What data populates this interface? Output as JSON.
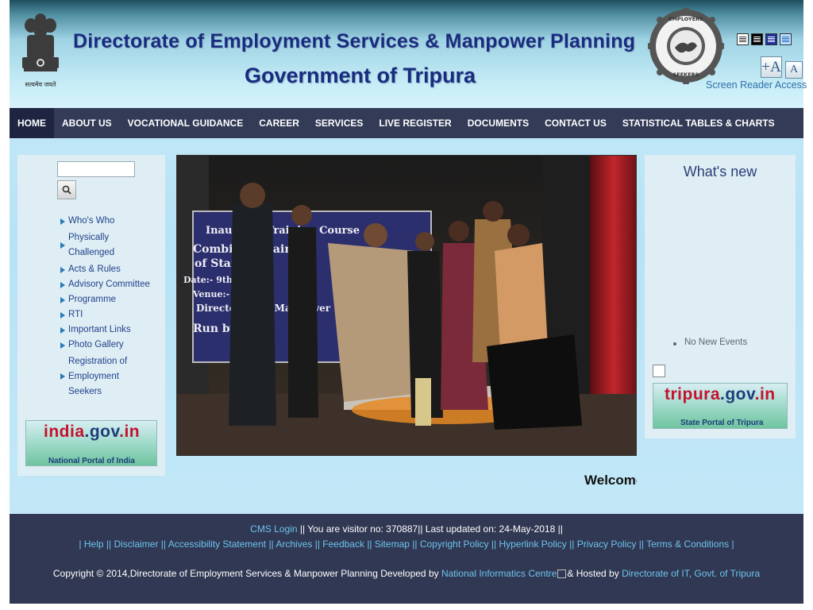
{
  "header": {
    "title_line1": "Directorate of Employment Services & Manpower Planning",
    "title_line2": "Government of Tripura",
    "emblem_motto": "सत्यमेव जयते",
    "seal_text": "FOR EMPLOYERS AND EMPLOYMENT SEEKERS",
    "font_increase_label": "+A",
    "font_normal_label": "A",
    "screen_reader_label": "Screen Reader Access",
    "contrast_options": [
      "contrast-default-icon",
      "contrast-dark-icon",
      "contrast-blue-icon",
      "contrast-light-blue-icon"
    ]
  },
  "nav": {
    "items": [
      {
        "label": "HOME",
        "active": true
      },
      {
        "label": "ABOUT US"
      },
      {
        "label": "VOCATIONAL GUIDANCE"
      },
      {
        "label": "CAREER"
      },
      {
        "label": "SERVICES"
      },
      {
        "label": "LIVE REGISTER"
      },
      {
        "label": "DOCUMENTS"
      },
      {
        "label": "CONTACT US"
      },
      {
        "label": "STATISTICAL TABLES & CHARTS"
      }
    ]
  },
  "sidebar": {
    "search_placeholder": "",
    "items": [
      {
        "label": "Who's Who"
      },
      {
        "label": "Physically Challenged"
      },
      {
        "label": "Acts & Rules"
      },
      {
        "label": "Advisory Committee"
      },
      {
        "label": "Programme"
      },
      {
        "label": "RTI"
      },
      {
        "label": "Important Links"
      },
      {
        "label": "Photo Gallery"
      },
      {
        "label": "Registration of Employment Seekers"
      }
    ],
    "banner": {
      "brand_prefix": "india",
      "brand_mid": ".gov",
      "brand_suffix": ".in",
      "caption": "National Portal of India"
    }
  },
  "main": {
    "slide_banner_lines": [
      "Inaugural Training Course",
      "Combined Training",
      "of Staff",
      "Date:- 9th January",
      "Venue:- Rab",
      "Directorate of Manpower",
      "Run by: "
    ],
    "marquee": "Welcome"
  },
  "right": {
    "heading": "What's new",
    "news": [
      "No New Events"
    ],
    "banner": {
      "brand_prefix": "tripura",
      "brand_mid": ".gov",
      "brand_suffix": ".in",
      "caption": "State Portal of Tripura"
    }
  },
  "footer": {
    "cms_login": "CMS Login",
    "visitor_text": " || You are visitor no: 370887|| Last updated on: 24-May-2018 ||",
    "links": [
      "Help",
      "Disclaimer",
      "Accessibility Statement",
      "Archives",
      "Feedback",
      "Sitemap",
      "Copyright Policy",
      "Hyperlink Policy",
      "Privacy Policy",
      "Terms & Conditions"
    ],
    "copyright": "Copyright © 2014,Directorate of Employment Services & Manpower Planning Developed by ",
    "nic_link": "National Informatics Centre",
    "hosted_text": "& Hosted by ",
    "dit_link": "Directorate of IT, Govt. of Tripura"
  },
  "colors": {
    "nav_bg": "#333b57",
    "nav_active": "#1f2540",
    "title": "#1a2c80",
    "footer_bg": "#313853",
    "footer_link": "#6cc4ec",
    "side_link": "#21418c"
  }
}
